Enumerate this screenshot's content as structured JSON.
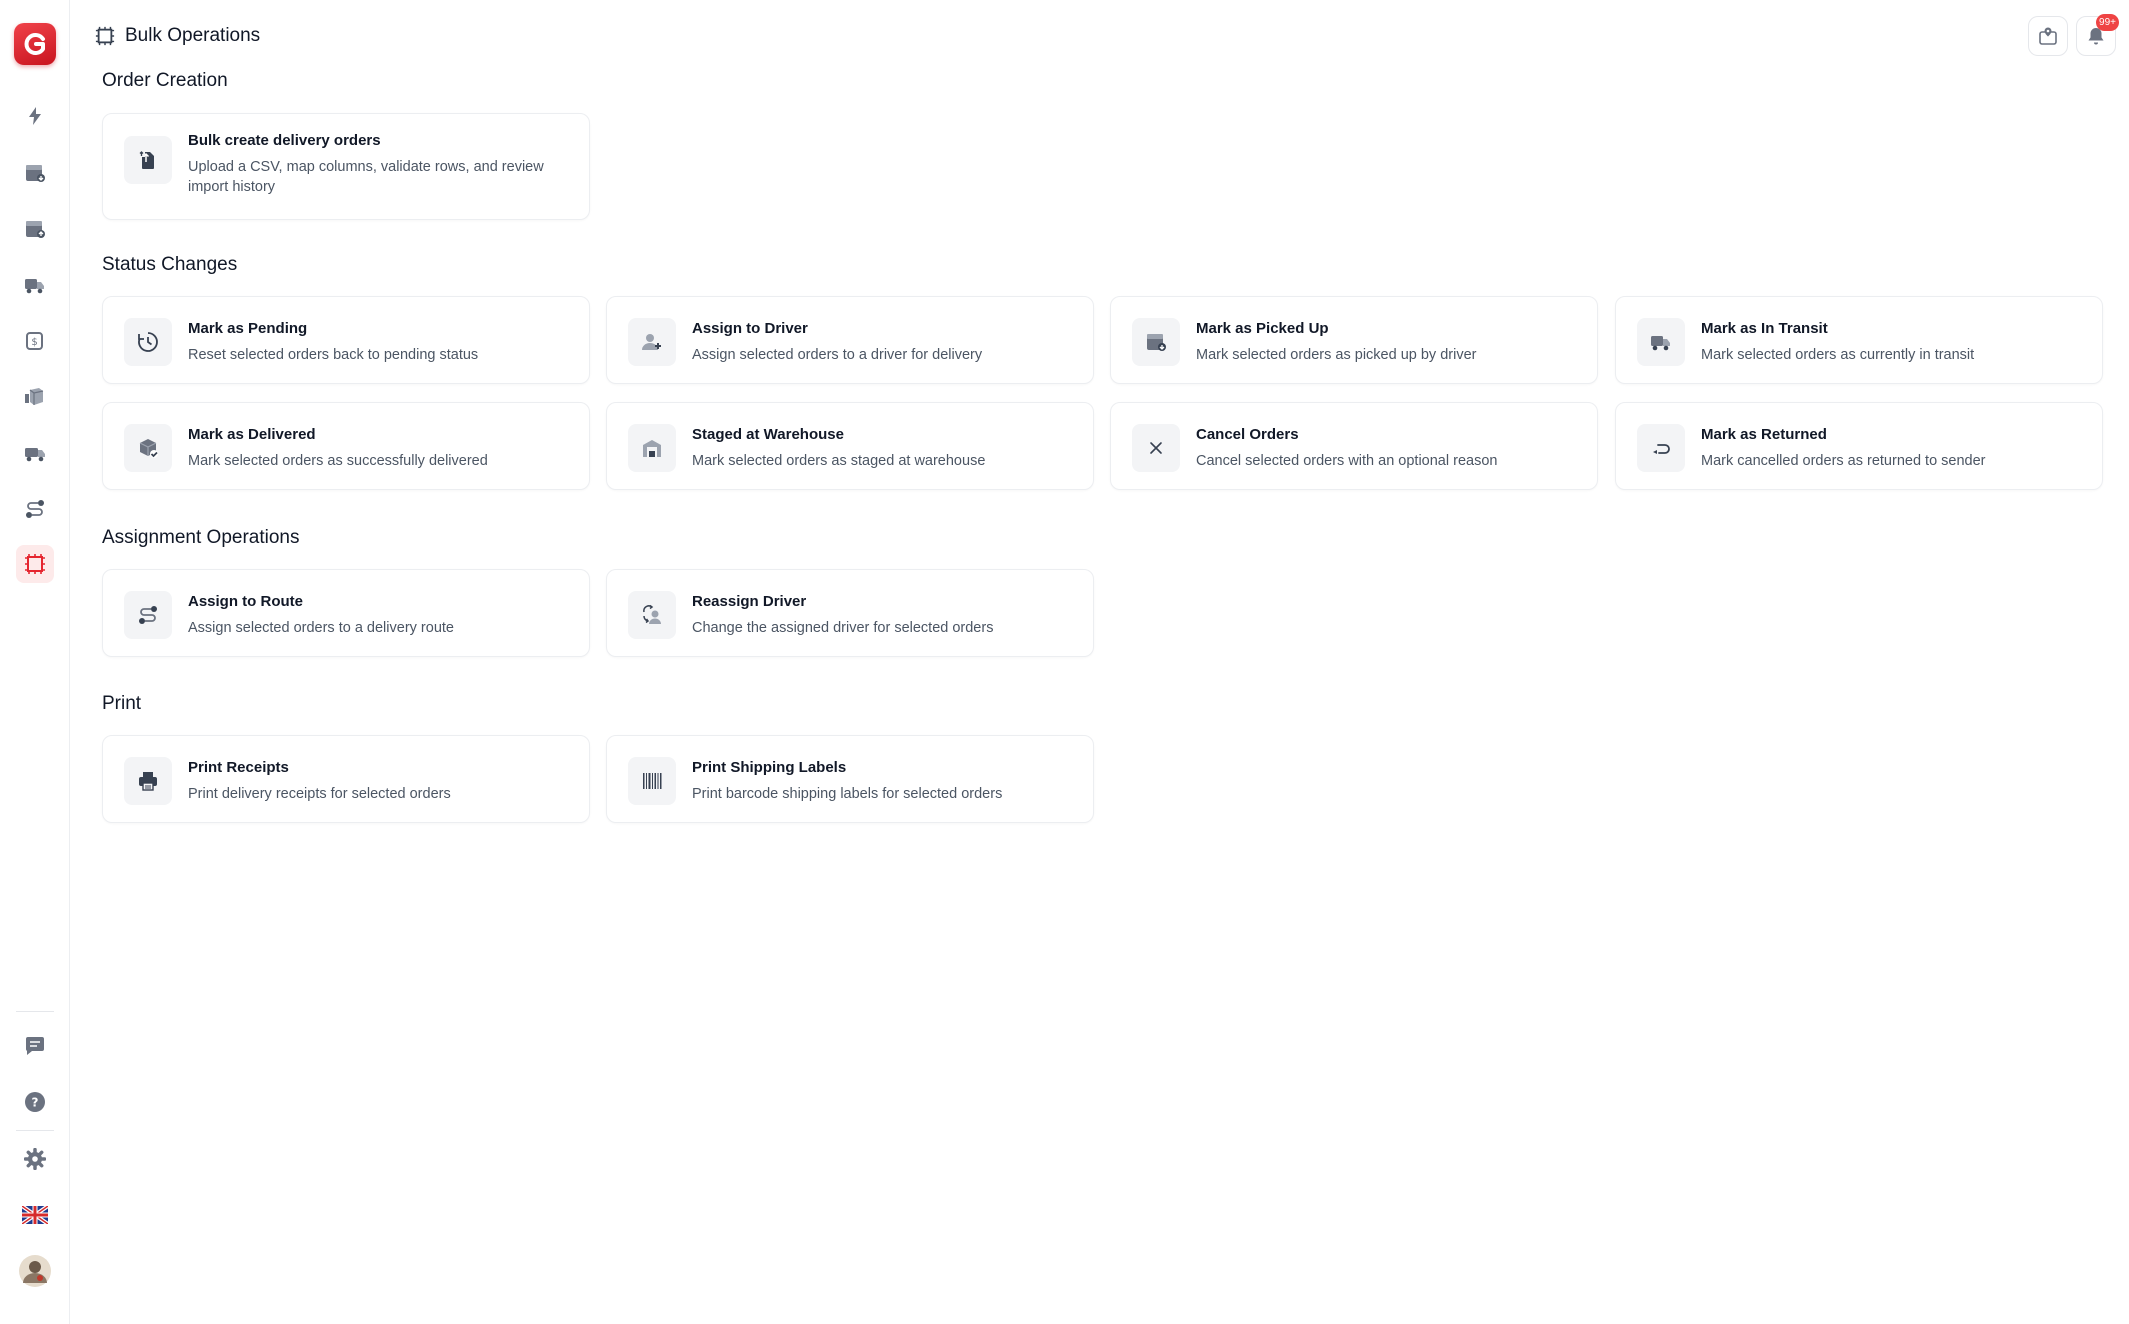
{
  "header": {
    "title": "Bulk Operations",
    "notification_badge": "99+"
  },
  "sidebar": {
    "items": [
      {
        "icon": "lightning-icon"
      },
      {
        "icon": "box-in-icon"
      },
      {
        "icon": "box-out-icon"
      },
      {
        "icon": "truck-icon"
      },
      {
        "icon": "cash-icon"
      },
      {
        "icon": "boxes-icon"
      },
      {
        "icon": "delivery-van-icon"
      },
      {
        "icon": "route-icon"
      },
      {
        "icon": "bulk-operations-icon",
        "active": true
      }
    ],
    "bottom": [
      {
        "icon": "chat-icon"
      },
      {
        "icon": "help-icon"
      },
      {
        "icon": "gear-icon"
      },
      {
        "icon": "uk-flag-icon"
      },
      {
        "icon": "avatar"
      }
    ]
  },
  "sections": {
    "order_creation": {
      "title": "Order Creation",
      "cards": [
        {
          "title": "Bulk create delivery orders",
          "desc": "Upload a CSV, map columns, validate rows, and review import history",
          "icon": "upload-file-icon"
        }
      ]
    },
    "status_changes": {
      "title": "Status Changes",
      "cards": [
        {
          "title": "Mark as Pending",
          "desc": "Reset selected orders back to pending status",
          "icon": "clock-icon"
        },
        {
          "title": "Assign to Driver",
          "desc": "Assign selected orders to a driver for delivery",
          "icon": "user-plus-icon"
        },
        {
          "title": "Mark as Picked Up",
          "desc": "Mark selected orders as picked up by driver",
          "icon": "package-pickup-icon"
        },
        {
          "title": "Mark as In Transit",
          "desc": "Mark selected orders as currently in transit",
          "icon": "truck-icon"
        },
        {
          "title": "Mark as Delivered",
          "desc": "Mark selected orders as successfully delivered",
          "icon": "package-check-icon"
        },
        {
          "title": "Staged at Warehouse",
          "desc": "Mark selected orders as staged at warehouse",
          "icon": "warehouse-icon"
        },
        {
          "title": "Cancel Orders",
          "desc": "Cancel selected orders with an optional reason",
          "icon": "close-icon"
        },
        {
          "title": "Mark as Returned",
          "desc": "Mark cancelled orders as returned to sender",
          "icon": "return-arrow-icon"
        }
      ]
    },
    "assignment_operations": {
      "title": "Assignment Operations",
      "cards": [
        {
          "title": "Assign to Route",
          "desc": "Assign selected orders to a delivery route",
          "icon": "route-icon"
        },
        {
          "title": "Reassign Driver",
          "desc": "Change the assigned driver for selected orders",
          "icon": "user-swap-icon"
        }
      ]
    },
    "print": {
      "title": "Print",
      "cards": [
        {
          "title": "Print Receipts",
          "desc": "Print delivery receipts for selected orders",
          "icon": "printer-icon"
        },
        {
          "title": "Print Shipping Labels",
          "desc": "Print barcode shipping labels for selected orders",
          "icon": "barcode-icon"
        }
      ]
    }
  },
  "colors": {
    "accent": "#e5252f",
    "active_bg": "#fdeaea",
    "text": "#111827",
    "muted": "#4b5563"
  }
}
